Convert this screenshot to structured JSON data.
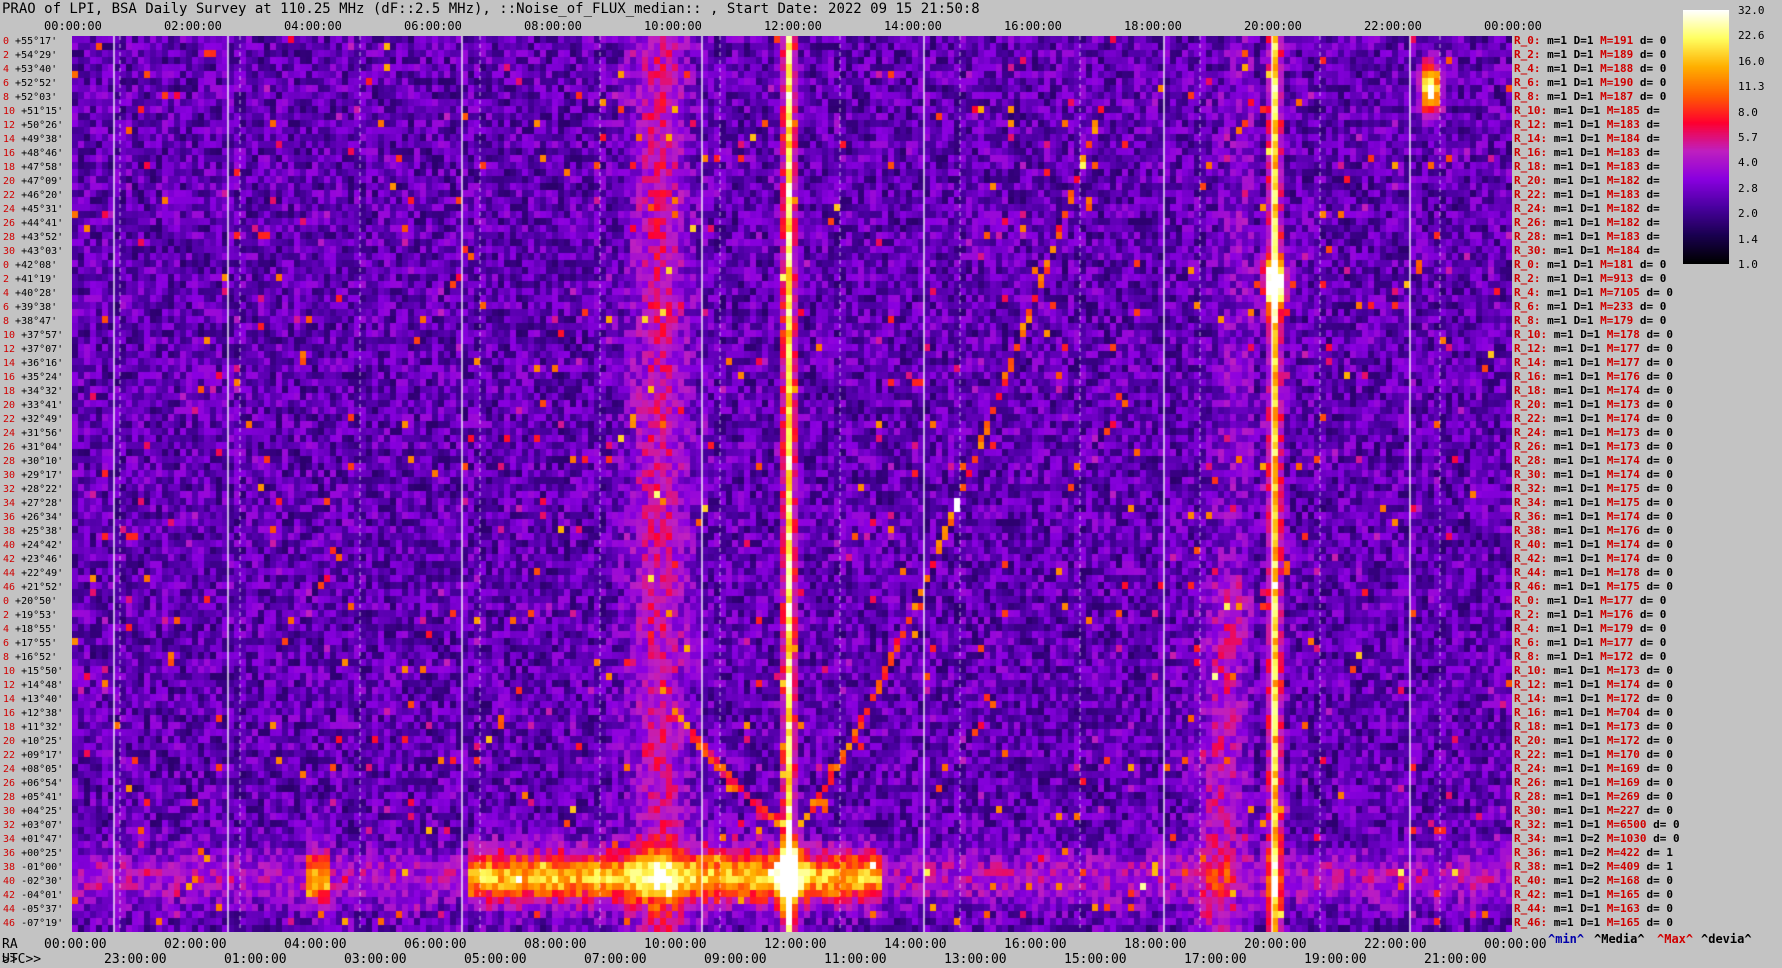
{
  "title": "PRAO of LPI, BSA Daily Survey at 110.25 MHz (dF::2.5 MHz), ::Noise_of_FLUX_median:: , Start Date: 2022 09 15 21:50:8",
  "chart_data": {
    "type": "heatmap",
    "top_axis_ticks": [
      "00:00:00",
      "02:00:00",
      "04:00:00",
      "06:00:00",
      "08:00:00",
      "10:00:00",
      "12:00:00",
      "14:00:00",
      "16:00:00",
      "18:00:00",
      "20:00:00",
      "22:00:00",
      "00:00:00"
    ],
    "ra_axis_label": "RA >>",
    "ra_axis_ticks": [
      "00:00:00",
      "02:00:00",
      "04:00:00",
      "06:00:00",
      "08:00:00",
      "10:00:00",
      "12:00:00",
      "14:00:00",
      "16:00:00",
      "18:00:00",
      "20:00:00",
      "22:00:00",
      "00:00:00"
    ],
    "utc_axis_label": "UTC>>",
    "utc_axis_ticks": [
      "23:00:00",
      "01:00:00",
      "03:00:00",
      "05:00:00",
      "07:00:00",
      "09:00:00",
      "11:00:00",
      "13:00:00",
      "15:00:00",
      "17:00:00",
      "19:00:00",
      "21:00:00"
    ],
    "declination_labels": [
      "+55°17'",
      "+54°29'",
      "+53°40'",
      "+52°52'",
      "+52°03'",
      "+51°15'",
      "+50°26'",
      "+49°38'",
      "+48°46'",
      "+47°58'",
      "+47°09'",
      "+46°20'",
      "+45°31'",
      "+44°41'",
      "+43°52'",
      "+43°03'",
      "+42°08'",
      "+41°19'",
      "+40°28'",
      "+39°38'",
      "+38°47'",
      "+37°57'",
      "+37°07'",
      "+36°16'",
      "+35°24'",
      "+34°32'",
      "+33°41'",
      "+32°49'",
      "+31°56'",
      "+31°04'",
      "+30°10'",
      "+29°17'",
      "+28°22'",
      "+27°28'",
      "+26°34'",
      "+25°38'",
      "+24°42'",
      "+23°46'",
      "+22°49'",
      "+21°52'",
      "+20°50'",
      "+19°53'",
      "+18°55'",
      "+17°55'",
      "+16°52'",
      "+15°50'",
      "+14°48'",
      "+13°40'",
      "+12°38'",
      "+11°32'",
      "+10°25'",
      "+09°17'",
      "+08°05'",
      "+06°54'",
      "+05°41'",
      "+04°25'",
      "+03°07'",
      "+01°47'",
      "+00°25'",
      "-01°00'",
      "-02°30'",
      "-04°01'",
      "-05°37'",
      "-07°19'"
    ],
    "declination_index": [
      "0",
      "2",
      "4",
      "6",
      "8",
      "10",
      "12",
      "14",
      "16",
      "18",
      "20",
      "22",
      "24",
      "26",
      "28",
      "30",
      "0",
      "2",
      "4",
      "6",
      "8",
      "10",
      "12",
      "14",
      "16",
      "18",
      "20",
      "22",
      "24",
      "26",
      "28",
      "30",
      "32",
      "34",
      "36",
      "38",
      "40",
      "42",
      "44",
      "46",
      "0",
      "2",
      "4",
      "6",
      "8",
      "10",
      "12",
      "14",
      "16",
      "18",
      "20",
      "22",
      "24",
      "26",
      "28",
      "30",
      "32",
      "34",
      "36",
      "38",
      "40",
      "42",
      "44",
      "46"
    ],
    "colorbar_ticks": [
      "32.0",
      "22.6",
      "16.0",
      "11.3",
      "8.0",
      "5.7",
      "4.0",
      "2.8",
      "2.0",
      "1.4",
      "1.0"
    ],
    "colorbar_range": [
      1.0,
      32.0
    ],
    "colorbar_scale": "log",
    "colormap_stops": [
      "#000000",
      "#1a0050",
      "#4a00a0",
      "#8a00e0",
      "#c020c0",
      "#ff0030",
      "#ff6000",
      "#ffb000",
      "#ffff60",
      "#ffffff"
    ],
    "vertical_solid_lines_ra_hours": [
      0.7,
      2.6,
      6.5,
      10.5,
      14.2,
      18.2,
      20.0,
      22.3
    ],
    "features": [
      {
        "type": "vertical_band",
        "ra_h": 11.9,
        "intensity": 9
      },
      {
        "type": "vertical_band",
        "ra_h": 20.0,
        "intensity": 8
      },
      {
        "type": "vertical_band",
        "ra_h": 9.75,
        "intensity": 3
      },
      {
        "type": "horizontal_band",
        "dec_from": "+01°47'",
        "dec_to": "-02°30'",
        "intensity": 6
      },
      {
        "type": "arc",
        "from_ra_h": 12.0,
        "to_ra_h": 17.2,
        "intensity": 6
      },
      {
        "type": "spot",
        "ra_h": 20.0,
        "dec": "+41°19'",
        "intensity": 10
      },
      {
        "type": "spot",
        "ra_h": 22.6,
        "dec": "+52°52'",
        "intensity": 9
      },
      {
        "type": "spot",
        "ra_h": 11.9,
        "dec": "+01°00'",
        "intensity": 10
      }
    ]
  },
  "right_panel": [
    {
      "r": "R_0:",
      "m": "m=1",
      "d": "D=1",
      "max": "M=191",
      "dev": "d= 0"
    },
    {
      "r": "R_2:",
      "m": "m=1",
      "d": "D=1",
      "max": "M=189",
      "dev": "d= 0"
    },
    {
      "r": "R_4:",
      "m": "m=1",
      "d": "D=1",
      "max": "M=188",
      "dev": "d= 0"
    },
    {
      "r": "R_6:",
      "m": "m=1",
      "d": "D=1",
      "max": "M=190",
      "dev": "d= 0"
    },
    {
      "r": "R_8:",
      "m": "m=1",
      "d": "D=1",
      "max": "M=187",
      "dev": "d= 0"
    },
    {
      "r": "R_10:",
      "m": "m=1",
      "d": "D=1",
      "max": "M=185",
      "dev": "d="
    },
    {
      "r": "R_12:",
      "m": "m=1",
      "d": "D=1",
      "max": "M=183",
      "dev": "d="
    },
    {
      "r": "R_14:",
      "m": "m=1",
      "d": "D=1",
      "max": "M=184",
      "dev": "d="
    },
    {
      "r": "R_16:",
      "m": "m=1",
      "d": "D=1",
      "max": "M=183",
      "dev": "d="
    },
    {
      "r": "R_18:",
      "m": "m=1",
      "d": "D=1",
      "max": "M=183",
      "dev": "d="
    },
    {
      "r": "R_20:",
      "m": "m=1",
      "d": "D=1",
      "max": "M=182",
      "dev": "d="
    },
    {
      "r": "R_22:",
      "m": "m=1",
      "d": "D=1",
      "max": "M=183",
      "dev": "d="
    },
    {
      "r": "R_24:",
      "m": "m=1",
      "d": "D=1",
      "max": "M=182",
      "dev": "d="
    },
    {
      "r": "R_26:",
      "m": "m=1",
      "d": "D=1",
      "max": "M=182",
      "dev": "d="
    },
    {
      "r": "R_28:",
      "m": "m=1",
      "d": "D=1",
      "max": "M=183",
      "dev": "d="
    },
    {
      "r": "R_30:",
      "m": "m=1",
      "d": "D=1",
      "max": "M=184",
      "dev": "d="
    },
    {
      "r": "R_0:",
      "m": "m=1",
      "d": "D=1",
      "max": "M=181",
      "dev": "d= 0"
    },
    {
      "r": "R_2:",
      "m": "m=1",
      "d": "D=1",
      "max": "M=913",
      "dev": "d= 0"
    },
    {
      "r": "R_4:",
      "m": "m=1",
      "d": "D=1",
      "max": "M=7105",
      "dev": "d= 0"
    },
    {
      "r": "R_6:",
      "m": "m=1",
      "d": "D=1",
      "max": "M=233",
      "dev": "d= 0"
    },
    {
      "r": "R_8:",
      "m": "m=1",
      "d": "D=1",
      "max": "M=179",
      "dev": "d= 0"
    },
    {
      "r": "R_10:",
      "m": "m=1",
      "d": "D=1",
      "max": "M=178",
      "dev": "d= 0"
    },
    {
      "r": "R_12:",
      "m": "m=1",
      "d": "D=1",
      "max": "M=177",
      "dev": "d= 0"
    },
    {
      "r": "R_14:",
      "m": "m=1",
      "d": "D=1",
      "max": "M=177",
      "dev": "d= 0"
    },
    {
      "r": "R_16:",
      "m": "m=1",
      "d": "D=1",
      "max": "M=176",
      "dev": "d= 0"
    },
    {
      "r": "R_18:",
      "m": "m=1",
      "d": "D=1",
      "max": "M=174",
      "dev": "d= 0"
    },
    {
      "r": "R_20:",
      "m": "m=1",
      "d": "D=1",
      "max": "M=173",
      "dev": "d= 0"
    },
    {
      "r": "R_22:",
      "m": "m=1",
      "d": "D=1",
      "max": "M=174",
      "dev": "d= 0"
    },
    {
      "r": "R_24:",
      "m": "m=1",
      "d": "D=1",
      "max": "M=173",
      "dev": "d= 0"
    },
    {
      "r": "R_26:",
      "m": "m=1",
      "d": "D=1",
      "max": "M=173",
      "dev": "d= 0"
    },
    {
      "r": "R_28:",
      "m": "m=1",
      "d": "D=1",
      "max": "M=174",
      "dev": "d= 0"
    },
    {
      "r": "R_30:",
      "m": "m=1",
      "d": "D=1",
      "max": "M=174",
      "dev": "d= 0"
    },
    {
      "r": "R_32:",
      "m": "m=1",
      "d": "D=1",
      "max": "M=175",
      "dev": "d= 0"
    },
    {
      "r": "R_34:",
      "m": "m=1",
      "d": "D=1",
      "max": "M=175",
      "dev": "d= 0"
    },
    {
      "r": "R_36:",
      "m": "m=1",
      "d": "D=1",
      "max": "M=174",
      "dev": "d= 0"
    },
    {
      "r": "R_38:",
      "m": "m=1",
      "d": "D=1",
      "max": "M=176",
      "dev": "d= 0"
    },
    {
      "r": "R_40:",
      "m": "m=1",
      "d": "D=1",
      "max": "M=174",
      "dev": "d= 0"
    },
    {
      "r": "R_42:",
      "m": "m=1",
      "d": "D=1",
      "max": "M=174",
      "dev": "d= 0"
    },
    {
      "r": "R_44:",
      "m": "m=1",
      "d": "D=1",
      "max": "M=178",
      "dev": "d= 0"
    },
    {
      "r": "R_46:",
      "m": "m=1",
      "d": "D=1",
      "max": "M=175",
      "dev": "d= 0"
    },
    {
      "r": "R_0:",
      "m": "m=1",
      "d": "D=1",
      "max": "M=177",
      "dev": "d= 0"
    },
    {
      "r": "R_2:",
      "m": "m=1",
      "d": "D=1",
      "max": "M=176",
      "dev": "d= 0"
    },
    {
      "r": "R_4:",
      "m": "m=1",
      "d": "D=1",
      "max": "M=179",
      "dev": "d= 0"
    },
    {
      "r": "R_6:",
      "m": "m=1",
      "d": "D=1",
      "max": "M=177",
      "dev": "d= 0"
    },
    {
      "r": "R_8:",
      "m": "m=1",
      "d": "D=1",
      "max": "M=172",
      "dev": "d= 0"
    },
    {
      "r": "R_10:",
      "m": "m=1",
      "d": "D=1",
      "max": "M=173",
      "dev": "d= 0"
    },
    {
      "r": "R_12:",
      "m": "m=1",
      "d": "D=1",
      "max": "M=174",
      "dev": "d= 0"
    },
    {
      "r": "R_14:",
      "m": "m=1",
      "d": "D=1",
      "max": "M=172",
      "dev": "d= 0"
    },
    {
      "r": "R_16:",
      "m": "m=1",
      "d": "D=1",
      "max": "M=704",
      "dev": "d= 0"
    },
    {
      "r": "R_18:",
      "m": "m=1",
      "d": "D=1",
      "max": "M=173",
      "dev": "d= 0"
    },
    {
      "r": "R_20:",
      "m": "m=1",
      "d": "D=1",
      "max": "M=172",
      "dev": "d= 0"
    },
    {
      "r": "R_22:",
      "m": "m=1",
      "d": "D=1",
      "max": "M=170",
      "dev": "d= 0"
    },
    {
      "r": "R_24:",
      "m": "m=1",
      "d": "D=1",
      "max": "M=169",
      "dev": "d= 0"
    },
    {
      "r": "R_26:",
      "m": "m=1",
      "d": "D=1",
      "max": "M=169",
      "dev": "d= 0"
    },
    {
      "r": "R_28:",
      "m": "m=1",
      "d": "D=1",
      "max": "M=269",
      "dev": "d= 0"
    },
    {
      "r": "R_30:",
      "m": "m=1",
      "d": "D=1",
      "max": "M=227",
      "dev": "d= 0"
    },
    {
      "r": "R_32:",
      "m": "m=1",
      "d": "D=1",
      "max": "M=6500",
      "dev": "d= 0"
    },
    {
      "r": "R_34:",
      "m": "m=1",
      "d": "D=2",
      "max": "M=1030",
      "dev": "d= 0"
    },
    {
      "r": "R_36:",
      "m": "m=1",
      "d": "D=2",
      "max": "M=422",
      "dev": "d= 1"
    },
    {
      "r": "R_38:",
      "m": "m=1",
      "d": "D=2",
      "max": "M=409",
      "dev": "d= 1"
    },
    {
      "r": "R_40:",
      "m": "m=1",
      "d": "D=2",
      "max": "M=168",
      "dev": "d= 0"
    },
    {
      "r": "R_42:",
      "m": "m=1",
      "d": "D=1",
      "max": "M=165",
      "dev": "d= 0"
    },
    {
      "r": "R_44:",
      "m": "m=1",
      "d": "D=1",
      "max": "M=163",
      "dev": "d= 0"
    },
    {
      "r": "R_46:",
      "m": "m=1",
      "d": "D=1",
      "max": "M=165",
      "dev": "d= 0"
    }
  ],
  "legend": {
    "min": "^min^",
    "median": "^Media^",
    "max": "^Max^",
    "devia": "^devia^"
  },
  "colors": {
    "min": "#0000aa",
    "median": "#000000",
    "max": "#d00000",
    "devia": "#000000"
  }
}
